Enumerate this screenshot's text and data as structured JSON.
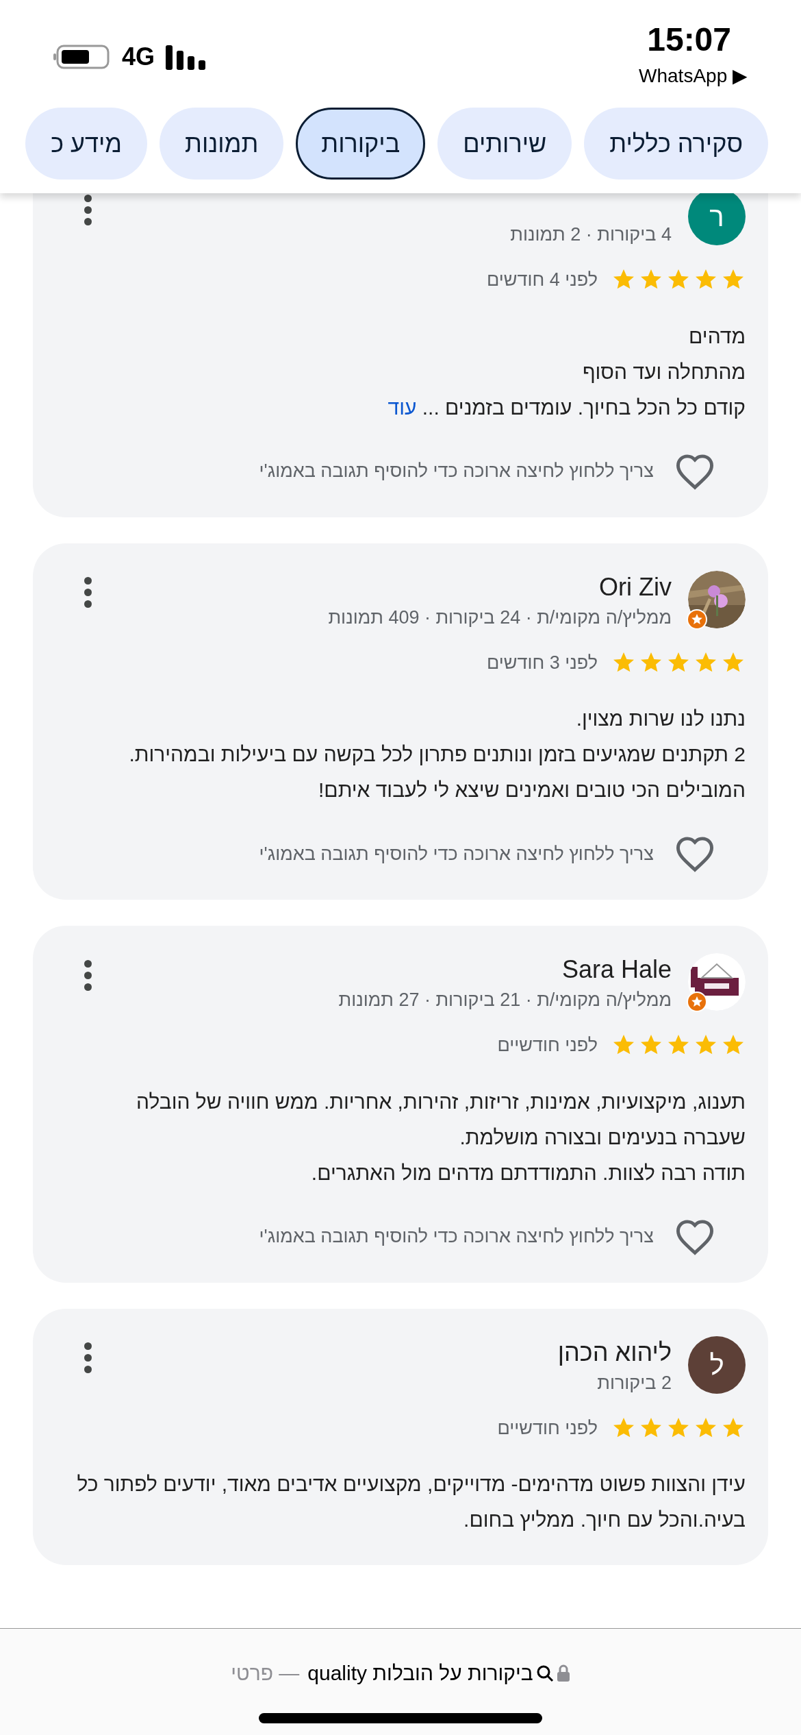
{
  "status_bar": {
    "time": "15:07",
    "back_app": "WhatsApp ▶",
    "network": "4G"
  },
  "tabs": [
    {
      "label": "סקירה כללית",
      "selected": false
    },
    {
      "label": "שירותים",
      "selected": false
    },
    {
      "label": "ביקורות",
      "selected": true
    },
    {
      "label": "תמונות",
      "selected": false
    },
    {
      "label": "מידע כ",
      "selected": false
    }
  ],
  "reviews": [
    {
      "avatar": {
        "kind": "letter",
        "letter": "ר",
        "color": "#00897b"
      },
      "local_guide": false,
      "meta": "4 ביקורות · 2 תמונות",
      "stars": 5,
      "date": "לפני 4 חודשים",
      "body": "מדהים\nמהתחלה ועד הסוף\nקודם כל הכל בחיוך. עומדים בזמנים ...",
      "more_link": "עוד",
      "footer": "צריך ללחוץ לחיצה ארוכה כדי להוסיף תגובה באמוג'י"
    },
    {
      "name": "Ori Ziv",
      "local_guide": true,
      "meta": "ממליץ/ה מקומי/ת · 24 ביקורות · 409 תמונות",
      "stars": 5,
      "date": "לפני 3 חודשים",
      "body": "נתנו לנו שרות מצוין.\n2 תקתנים שמגיעים בזמן ונותנים פתרון לכל בקשה עם ביעילות ובמהירות.\nהמובילים הכי טובים ואמינים שיצא לי לעבוד איתם!",
      "footer": "צריך ללחוץ לחיצה ארוכה כדי להוסיף תגובה באמוג'י"
    },
    {
      "name": "Sara Hale",
      "local_guide": true,
      "meta": "ממליץ/ה מקומי/ת · 21 ביקורות · 27 תמונות",
      "stars": 5,
      "date": "לפני חודשיים",
      "body": "תענוג, מיקצועיות, אמינות, זריזות, זהירות, אחריות. ממש חוויה של הובלה שעברה בנעימים ובצורה מושלמת.\nתודה רבה לצוות. התמודדתם מדהים מול האתגרים.",
      "footer": "צריך ללחוץ לחיצה ארוכה כדי להוסיף תגובה באמוג'י"
    },
    {
      "name": "ליהוא הכהן",
      "avatar": {
        "kind": "letter",
        "letter": "ל",
        "color": "#5d4037"
      },
      "local_guide": false,
      "meta": "2 ביקורות",
      "stars": 5,
      "date": "לפני חודשיים",
      "body": "עידן והצוות פשוט מדהימים- מדוייקים, מקצועיים אדיבים מאוד, יודעים לפתור כל בעיה.והכל עם חיוך. ממליץ בחום."
    }
  ],
  "url_bar": {
    "title": "ביקורות על הובלות quality",
    "mode": "— פרטי"
  }
}
